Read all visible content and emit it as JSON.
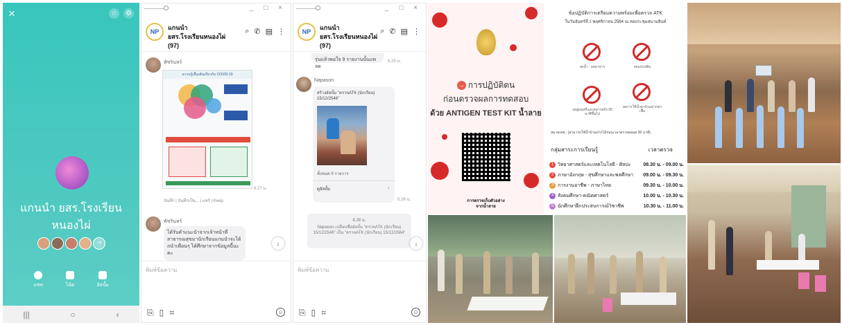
{
  "panel1": {
    "close_icon": "×",
    "group_name_line1": "แกนนำ ยสร.โรงเรียน",
    "group_name_line2": "หนองไผ่",
    "members_more": "+9",
    "actions": [
      {
        "label": "แชท",
        "icon": "chat-icon"
      },
      {
        "label": "โน้ต",
        "icon": "note-icon"
      },
      {
        "label": "อัลบั้ม",
        "icon": "album-icon"
      }
    ]
  },
  "chat_common": {
    "group_logo": "NP",
    "title_line1": "แกนนำ",
    "title_line2": "ยสร.โรงเรียนหนองไผ่ (97)",
    "window_controls": "_ □ ×",
    "input_placeholder": "พิมพ์ข้อความ"
  },
  "chat2": {
    "sender1": "พัชรินทร์",
    "time1": "6.27 น.",
    "reactions": "บันทึก | บันทึกเป็น... | แชร์ | Keep",
    "sender2": "พัชรินทร์",
    "message2": "ได้รับคำแนะนำจากเจ้าหน้าที่สาธารณสุขมานักเรียนแกนนำจะได้ถนำเพื่อนๆ ได้ศึกษาจากข้อมูลนี้นะคะ",
    "infographic_title": "ความรู้เบื้องต้นเกี่ยวกับ COVID-19"
  },
  "chat3": {
    "prev_bubble": "รุ่นแล้วพอใจ 9 รายงานนั้นแพลด",
    "prev_time": "6.29 น.",
    "sender": "Napason",
    "album_title": "สร้างอัลบั้ม \"ตรวจATK (นักเรียน) 15/12/2546\"",
    "album_count": "ทั้งหมด 9 รายการ",
    "view_album": "ดูอัลบั้ม",
    "time": "8.28 น.",
    "sys_time": "8.28 น.",
    "sys_message": "Napason เปลี่ยนชื่ออัลบั้ม \"ตรวจATK (นักเรียน) 15/12/2546\" เป็น \"ตรวจATK (นักเรียน) 15/12/2564\""
  },
  "poster_left": {
    "line1": "การปฏิบัติตน",
    "line2": "ก่อนตรวจผลการทดสอบ",
    "line3": "ด้วย ANTIGEN TEST KIT น้ำลาย",
    "qr_caption_1": "การตรวจเก็บตัวอย่าง",
    "qr_caption_2": "จากน้ำลาย"
  },
  "poster_right": {
    "title1": "ข้อปฏิบัติการเตรียมความพร้อมเพื่อตรวจ ATK",
    "title2": "ในวันจันทร์ที่ 1 พฤศจิกายน 2564  ณ  หอประชุมสนามอินท์",
    "signs": [
      "งดน้ำ - งดอาหาร",
      "งดแปรงฟัน",
      "งดสูบบุหรี่และหมากฝรั่ง 30 นาทีขึ้นไป",
      "งดการใช้น้ำยาบ้วนปากฆ่าเชื้อ"
    ],
    "note": "หมายเหตุ : (สามารถใช้น้ำบ้วนปากได้ก่อนเวลาตรวจตลอด 30 นาที)",
    "col_group": "กลุ่มสาระการเรียนรู้",
    "col_time": "เวลาตรวจ",
    "rows": [
      {
        "n": "1",
        "group": "วิทยาศาสตร์และเทคโนโลยี - ศิลปะ",
        "time": "08.30 น. - 09.00 น.",
        "color": "#e8493c"
      },
      {
        "n": "2",
        "group": "ภาษาอังกฤษ - สุขศึกษาและพลศึกษา",
        "time": "09.00 น. - 09.30 น.",
        "color": "#e8493c"
      },
      {
        "n": "3",
        "group": "การงานอาชีพ - ภาษาไทย",
        "time": "09.30 น. - 10.00 น.",
        "color": "#e89a3c"
      },
      {
        "n": "4",
        "group": "สังคมศึกษา-คณิตศาสตร์",
        "time": "10.00 น. - 10.30 น.",
        "color": "#a35ac8"
      },
      {
        "n": "5",
        "group": "นักศึกษาฝึกประสบการณ์วิชาชีพ",
        "time": "10.30 น. - 11.00 น.",
        "color": "#c07ad8"
      }
    ]
  },
  "colors": {
    "panel1_bg": "#4fc9c0",
    "accent_red": "#d62a2a",
    "chat_bubble": "#f1f1f3"
  }
}
